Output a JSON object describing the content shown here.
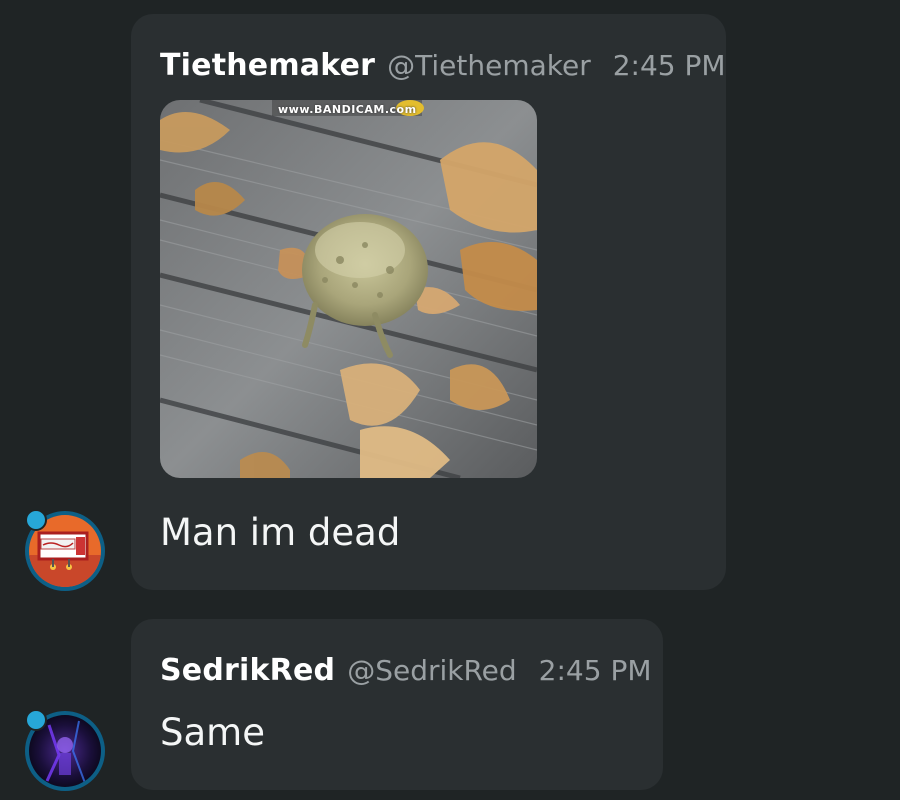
{
  "messages": [
    {
      "username": "Tiethemaker",
      "handle": "@Tiethemaker",
      "time": "2:45 PM",
      "attachment": {
        "watermark": "www.BANDICAM.com"
      },
      "text": "Man im dead"
    },
    {
      "username": "SedrikRed",
      "handle": "@SedrikRed",
      "time": "2:45 PM",
      "text": "Same"
    }
  ],
  "colors": {
    "background": "#1f2425",
    "bubble": "#2a2f31",
    "avatar_ring": "#0d5f86",
    "badge": "#27a7d8"
  },
  "icons": [
    "avatar-tiethemaker",
    "avatar-sedrikred",
    "status-badge-icon"
  ]
}
